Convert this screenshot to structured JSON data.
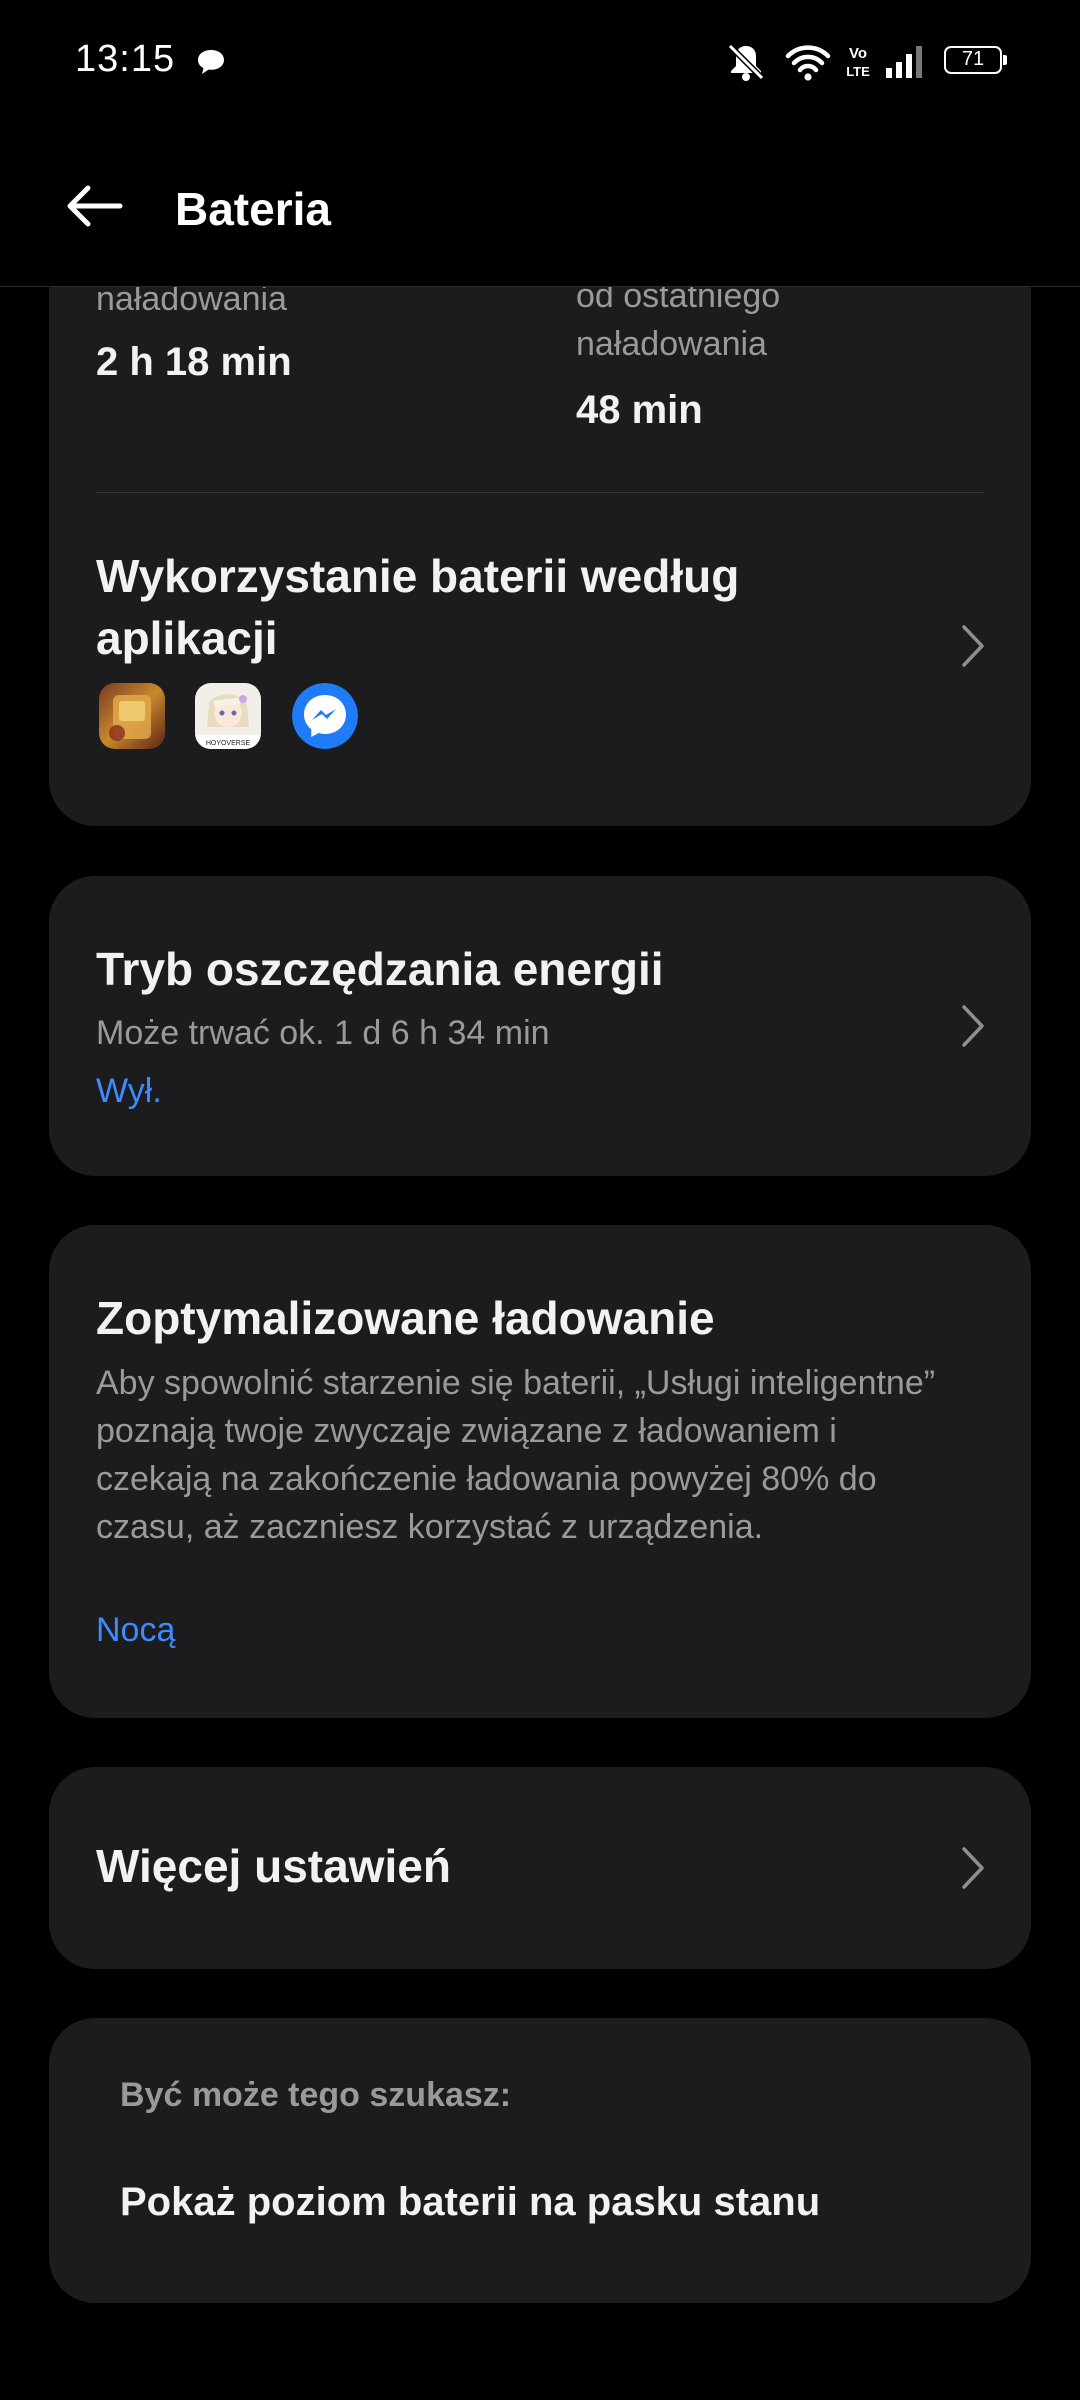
{
  "status_bar": {
    "time": "13:15",
    "battery_level": "71",
    "icons": [
      "chat-bubble-icon",
      "mute-icon",
      "wifi-icon",
      "volte-icon",
      "signal-icon",
      "battery-icon"
    ]
  },
  "app_bar": {
    "title": "Bateria",
    "back_icon": "arrow-left-icon"
  },
  "usage_card": {
    "left_label": "naładowania",
    "left_value": "2 h 18 min",
    "right_label": "od ostatniego naładowania",
    "right_value": "48 min",
    "apps_title": "Wykorzystanie baterii według aplikacji",
    "app_icons": [
      "game-app-icon",
      "hoyoverse-app-icon",
      "messenger-app-icon"
    ],
    "app_icon_badge": "HOYOVERSE"
  },
  "saver_card": {
    "title": "Tryb oszczędzania energii",
    "subtitle": "Może trwać ok. 1 d 6 h 34 min",
    "status": "Wył."
  },
  "optimized_card": {
    "title": "Zoptymalizowane ładowanie",
    "description": "Aby spowolnić starzenie się baterii, „Usługi inteligentne” poznają twoje zwyczaje związane z ładowaniem i czekają na zakończenie ładowania powyżej 80% do czasu, aż zaczniesz korzystać z urządzenia.",
    "status": "Nocą"
  },
  "more_card": {
    "title": "Więcej ustawień"
  },
  "suggest_card": {
    "header": "Być może tego szukasz:",
    "item": "Pokaż poziom baterii na pasku stanu"
  },
  "colors": {
    "background": "#000000",
    "card": "#1c1c1e",
    "accent": "#3d8bff",
    "primary_text": "#f2f2f2",
    "secondary_text": "#9a9a9a"
  }
}
